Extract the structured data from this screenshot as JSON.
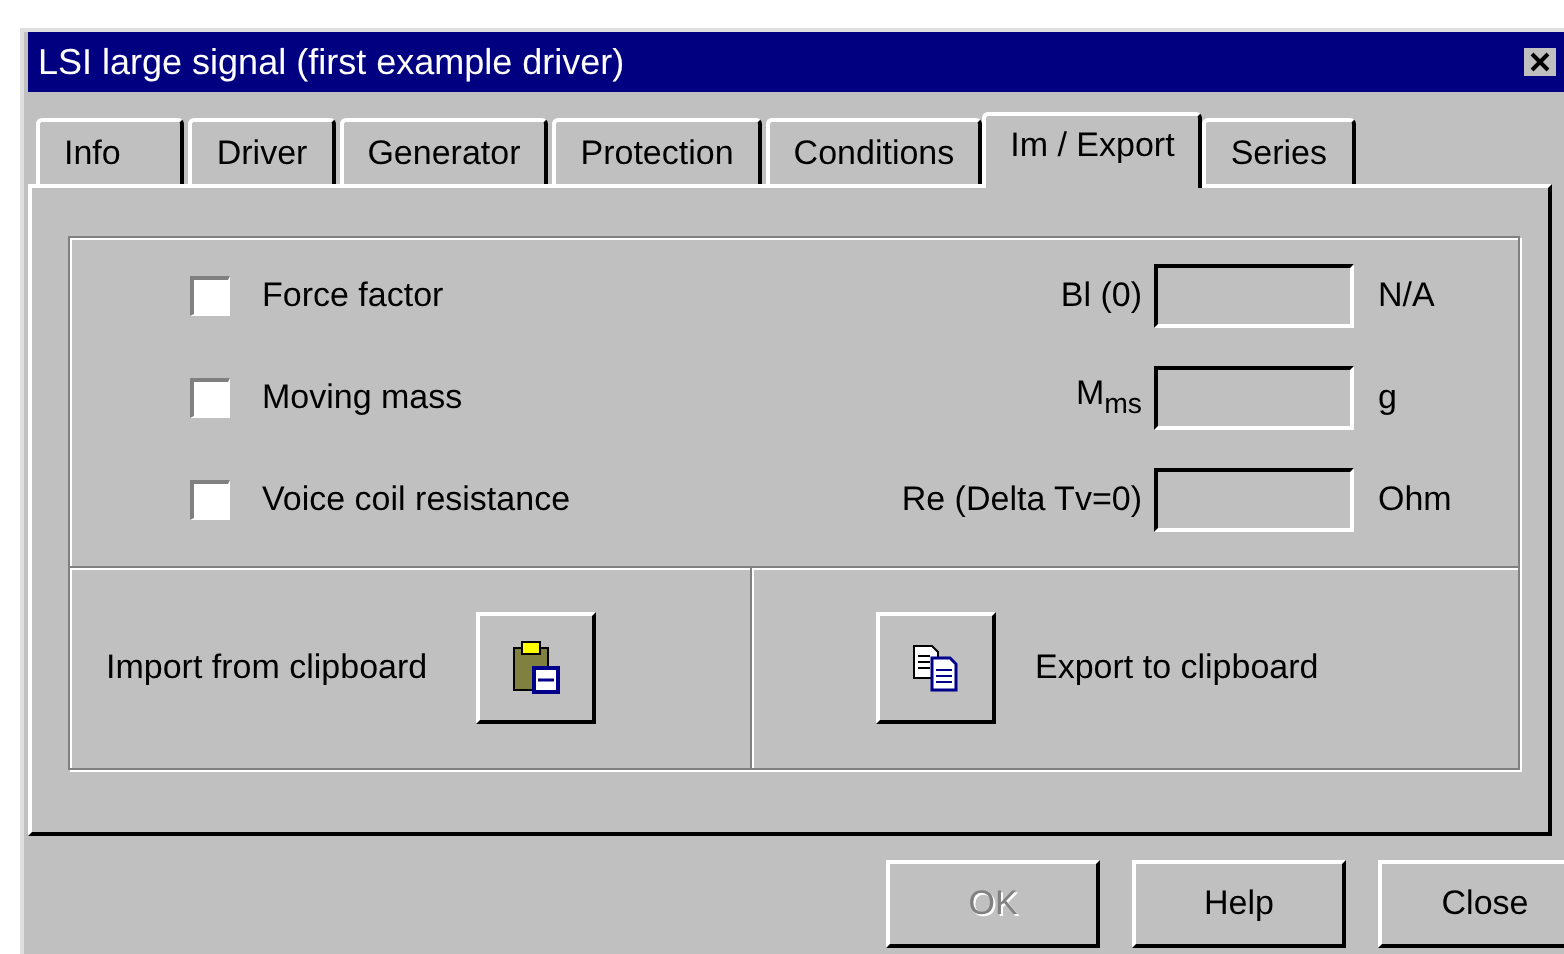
{
  "window": {
    "title": "LSI large signal (first example driver)"
  },
  "tabs": [
    {
      "label": "Info",
      "selected": false
    },
    {
      "label": "Driver",
      "selected": false
    },
    {
      "label": "Generator",
      "selected": false
    },
    {
      "label": "Protection",
      "selected": false
    },
    {
      "label": "Conditions",
      "selected": false
    },
    {
      "label": "Im / Export",
      "selected": true
    },
    {
      "label": "Series",
      "selected": false
    }
  ],
  "parameters": [
    {
      "label": "Force factor",
      "checked": false,
      "symbol": "Bl (0)",
      "unit": "N/A"
    },
    {
      "label": "Moving mass",
      "checked": false,
      "symbol": "M$_{ms}$",
      "unit": "g"
    },
    {
      "label": "Voice coil resistance",
      "checked": false,
      "symbol": "Re (Delta Tv=0)",
      "unit": "Ohm"
    }
  ],
  "import": {
    "label": "Import from clipboard"
  },
  "export": {
    "label": "Export to clipboard"
  },
  "buttons": [
    {
      "label": "OK",
      "disabled": true
    },
    {
      "label": "Help",
      "disabled": false
    },
    {
      "label": "Close",
      "disabled": false
    }
  ]
}
